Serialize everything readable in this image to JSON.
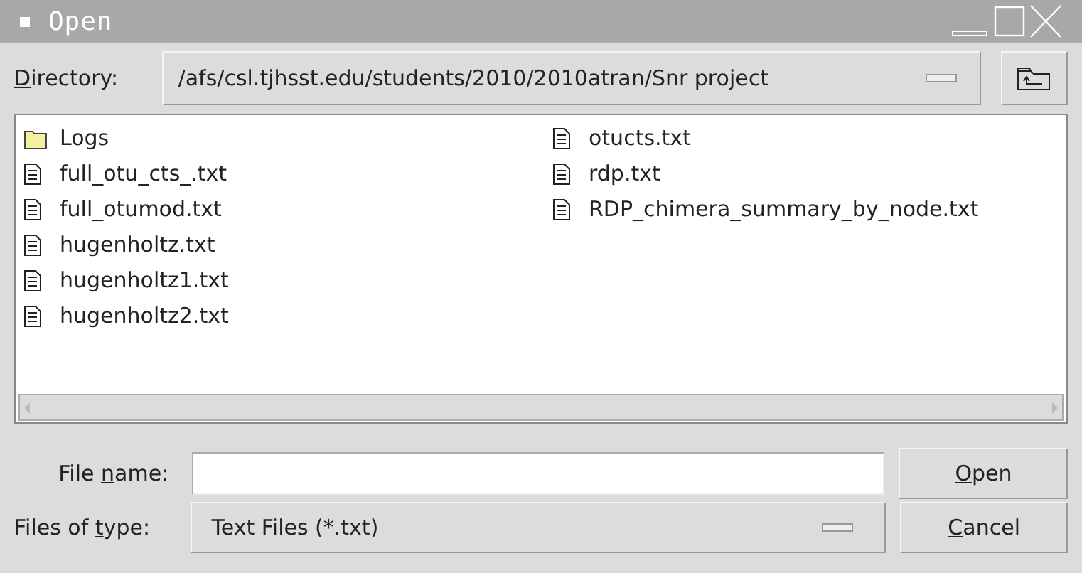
{
  "window": {
    "title": "Open"
  },
  "directory": {
    "label": {
      "key": "D",
      "after": "irectory:"
    },
    "value": "/afs/csl.tjhsst.edu/students/2010/2010atran/Snr project"
  },
  "files": [
    {
      "name": "Logs",
      "kind": "folder"
    },
    {
      "name": "full_otu_cts_.txt",
      "kind": "file"
    },
    {
      "name": "full_otumod.txt",
      "kind": "file"
    },
    {
      "name": "hugenholtz.txt",
      "kind": "file"
    },
    {
      "name": "hugenholtz1.txt",
      "kind": "file"
    },
    {
      "name": "hugenholtz2.txt",
      "kind": "file"
    },
    {
      "name": "otucts.txt",
      "kind": "file"
    },
    {
      "name": "rdp.txt",
      "kind": "file"
    },
    {
      "name": "RDP_chimera_summary_by_node.txt",
      "kind": "file"
    }
  ],
  "file_name": {
    "label": {
      "before": "File ",
      "key": "n",
      "after": "ame:"
    }
  },
  "file_type": {
    "label": {
      "before": "Files of ",
      "key": "t",
      "after": "ype:"
    },
    "value": "Text Files (*.txt)"
  },
  "buttons": [
    {
      "key": "O",
      "after": "pen"
    },
    {
      "key": "C",
      "after": "ancel"
    }
  ]
}
